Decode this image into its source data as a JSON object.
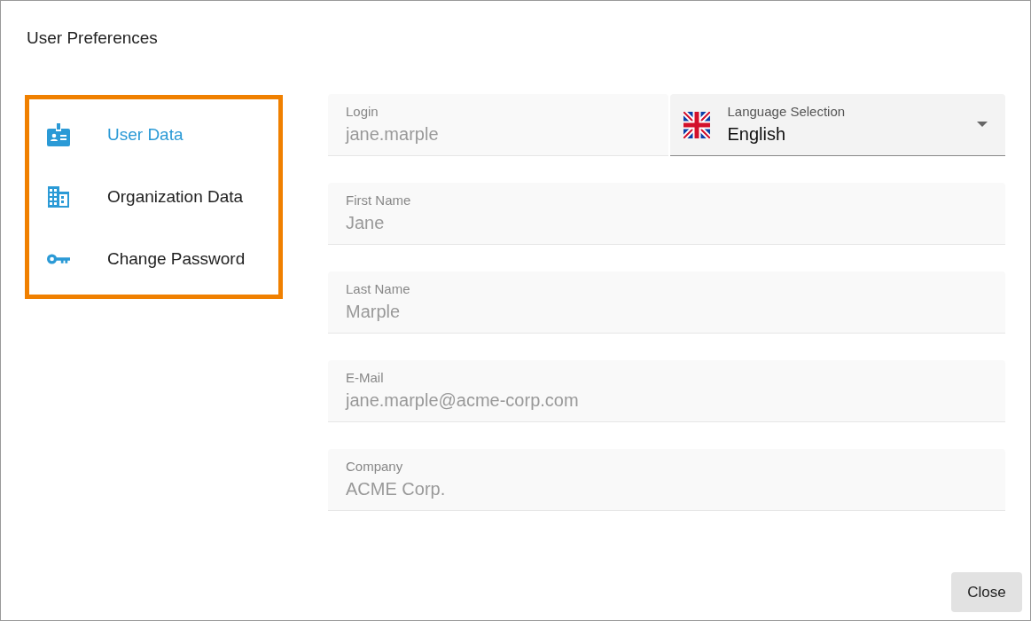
{
  "dialog": {
    "title": "User Preferences"
  },
  "nav": {
    "highlighted": true,
    "items": [
      {
        "label": "User Data",
        "kind": "badge",
        "selected": true
      },
      {
        "label": "Organization Data",
        "kind": "building",
        "selected": false
      },
      {
        "label": "Change Password",
        "kind": "key",
        "selected": false
      }
    ]
  },
  "login": {
    "label": "Login",
    "value": "jane.marple",
    "disabled": true
  },
  "language": {
    "label": "Language Selection",
    "value": "English"
  },
  "fields": [
    {
      "label": "First Name",
      "value": "Jane",
      "disabled": true
    },
    {
      "label": "Last Name",
      "value": "Marple",
      "disabled": true
    },
    {
      "label": "E-Mail",
      "value": "jane.marple@acme-corp.com",
      "disabled": true
    },
    {
      "label": "Company",
      "value": "ACME Corp.",
      "disabled": true
    }
  ],
  "buttons": [
    {
      "label": "Close"
    }
  ]
}
